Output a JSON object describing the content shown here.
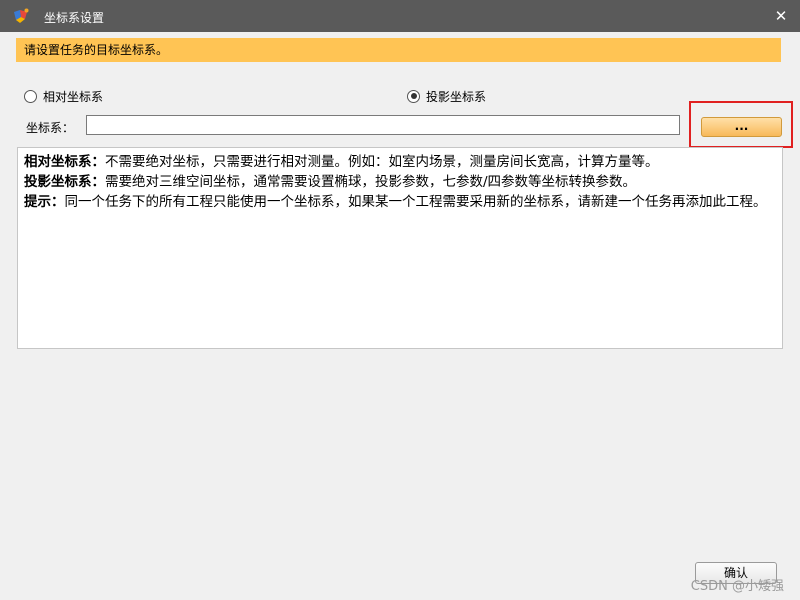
{
  "window": {
    "title": "坐标系设置",
    "close_glyph": "✕"
  },
  "notice": {
    "text": "请设置任务的目标坐标系。",
    "bg_color": "#ffc454"
  },
  "options": {
    "relative_label": "相对坐标系",
    "projected_label": "投影坐标系",
    "selected": "projected"
  },
  "coordinate_system": {
    "label": "坐标系：",
    "value": "",
    "browse_label": "..."
  },
  "info": {
    "lines": [
      {
        "heading": "相对坐标系：",
        "body": "不需要绝对坐标，只需要进行相对测量。例如：如室内场景，测量房间长宽高，计算方量等。"
      },
      {
        "heading": "投影坐标系：",
        "body": "需要绝对三维空间坐标，通常需要设置椭球，投影参数，七参数/四参数等坐标转换参数。"
      },
      {
        "heading": "提示：",
        "body": "同一个任务下的所有工程只能使用一个坐标系，如果某一个工程需要采用新的坐标系，请新建一个任务再添加此工程。"
      }
    ]
  },
  "footer": {
    "confirm_label": "确认",
    "watermark": "CSDN @小矮强"
  },
  "colors": {
    "titlebar": "#5a5a5a",
    "highlight": "#e02020",
    "browse_button": "#f8b95a"
  }
}
